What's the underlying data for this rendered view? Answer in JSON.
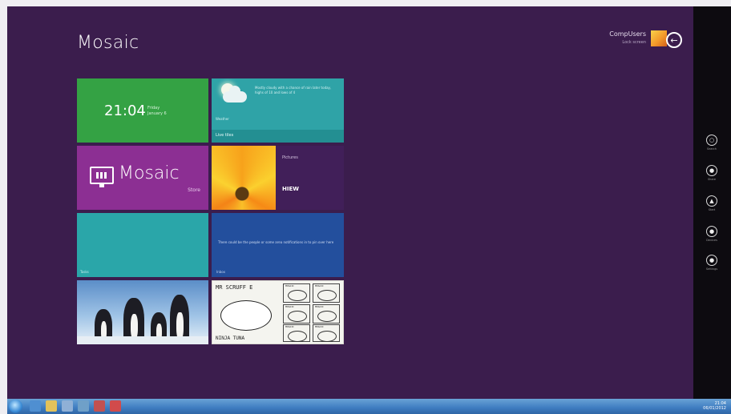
{
  "app": {
    "title": "Mosaic"
  },
  "header": {
    "user_name": "CompUsers",
    "user_sub": "Lock screen",
    "back_glyph": "←"
  },
  "tiles": {
    "clock": {
      "time": "21:04",
      "line1": "Friday",
      "line2": "January 6"
    },
    "weather": {
      "text": "Mostly cloudy with a chance of rain later today, highs of 10 and lows of 4",
      "label": "Weather",
      "bar_text": "Live tiles"
    },
    "store": {
      "title": "Mosaic",
      "subtitle": "Store"
    },
    "flower": {
      "title": "Pictures",
      "value": "HIEW"
    },
    "teal": {
      "label": "Tasks"
    },
    "blue": {
      "text": "There could be the people or some area notifications in to pin over here",
      "label": "Inbox"
    },
    "comic": {
      "header": "MR SCRUFF E",
      "footer": "NINJA TUNA",
      "cell_label": "MOSAIC"
    }
  },
  "charms": [
    {
      "name": "search-charm",
      "icon": "search-icon",
      "glyph": "○",
      "label": "Search"
    },
    {
      "name": "share-charm",
      "icon": "share-icon",
      "glyph": "●",
      "label": "Share"
    },
    {
      "name": "start-charm",
      "icon": "start-icon",
      "glyph": "▲",
      "label": "Start"
    },
    {
      "name": "devices-charm",
      "icon": "devices-icon",
      "glyph": "●",
      "label": "Devices"
    },
    {
      "name": "settings-charm",
      "icon": "settings-icon",
      "glyph": "●",
      "label": "Settings"
    }
  ],
  "taskbar": {
    "tray_time": "21:04",
    "tray_date": "06/01/2012"
  },
  "colors": {
    "background": "#3b1d4d",
    "clock_tile": "#34a244",
    "weather_tile": "#2fa3a7",
    "store_tile": "#8c2f93",
    "blue_tile": "#234f9d",
    "charms_bar": "#0d0b10"
  }
}
